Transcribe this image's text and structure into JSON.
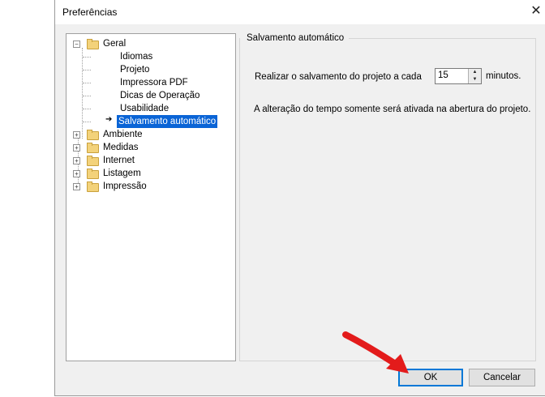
{
  "window": {
    "title": "Preferências",
    "close_label": "✕"
  },
  "tree": {
    "items": [
      {
        "label": "Geral",
        "expander": "⊟",
        "children": [
          "Idiomas",
          "Projeto",
          "Impressora PDF",
          "Dicas de Operação",
          "Usabilidade",
          "Salvamento automático"
        ]
      },
      {
        "label": "Ambiente",
        "expander": "⊞"
      },
      {
        "label": "Medidas",
        "expander": "⊞"
      },
      {
        "label": "Internet",
        "expander": "⊞"
      },
      {
        "label": "Listagem",
        "expander": "⊞"
      },
      {
        "label": "Impressão",
        "expander": "⊞"
      }
    ],
    "selected": "Salvamento automático"
  },
  "panel": {
    "group_title": "Salvamento automático",
    "save_prefix": "Realizar o salvamento do projeto a cada",
    "save_value": "15",
    "save_suffix": "minutos.",
    "note": "A alteração do tempo somente será ativada na abertura do projeto."
  },
  "buttons": {
    "ok": "OK",
    "cancel": "Cancelar"
  },
  "colors": {
    "selection": "#0a64d6",
    "annotation_arrow": "#e31b1b",
    "ok_border": "#0078d7"
  }
}
